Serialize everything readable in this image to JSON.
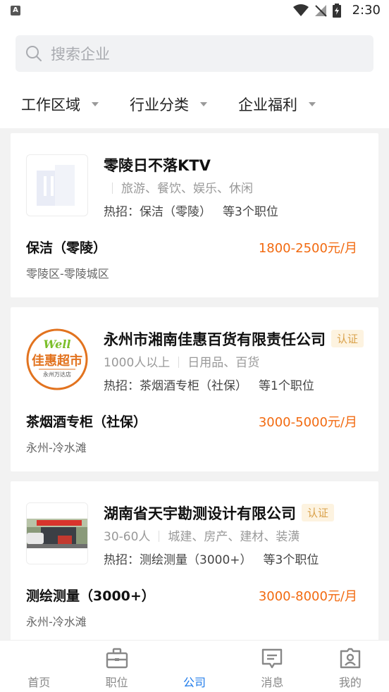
{
  "status_bar": {
    "time": "2:30",
    "left_icon": "A"
  },
  "search": {
    "placeholder": "搜索企业",
    "value": ""
  },
  "filters": [
    {
      "label": "工作区域"
    },
    {
      "label": "行业分类"
    },
    {
      "label": "企业福利"
    }
  ],
  "companies": [
    {
      "name": "零陵日不落KTV",
      "certified": false,
      "size": "",
      "industry": "旅游、餐饮、娱乐、休闲",
      "hot_prefix": "热招：",
      "hot_job": "保洁（零陵）",
      "hot_more": "等3个职位",
      "job_title": "保洁（零陵）",
      "salary": "1800-2500元/月",
      "location": "零陵区-零陵城区",
      "logo": "building-placeholder-icon"
    },
    {
      "name": "永州市湘南佳惠百货有限责任公司",
      "certified": true,
      "badge": "认证",
      "size": "1000人以上",
      "industry": "日用品、百货",
      "hot_prefix": "热招：",
      "hot_job": "茶烟酒专柜（社保）",
      "hot_more": "等1个职位",
      "job_title": "茶烟酒专柜（社保）",
      "salary": "3000-5000元/月",
      "location": "永州-冷水滩",
      "logo": "jiahui-supermarket-logo",
      "logo_text": {
        "well": "Well",
        "name": "佳惠超市",
        "branch": "永州万达店"
      }
    },
    {
      "name": "湖南省天宇勘测设计有限公司",
      "certified": true,
      "badge": "认证",
      "size": "30-60人",
      "industry": "城建、房产、建材、装潢",
      "hot_prefix": "热招：",
      "hot_job": "测绘测量（3000+）",
      "hot_more": "等3个职位",
      "job_title": "测绘测量（3000+）",
      "salary": "3000-8000元/月",
      "location": "永州-冷水滩",
      "logo": "storefront-photo"
    }
  ],
  "tabs": [
    {
      "label": "首页",
      "icon": "home-icon",
      "active": false
    },
    {
      "label": "职位",
      "icon": "briefcase-icon",
      "active": false
    },
    {
      "label": "公司",
      "icon": "company-icon",
      "active": true
    },
    {
      "label": "消息",
      "icon": "message-icon",
      "active": false
    },
    {
      "label": "我的",
      "icon": "profile-icon",
      "active": false
    }
  ],
  "colors": {
    "accent": "#1f7bea",
    "salary": "#f26a10",
    "badge_bg": "#fdf3e0",
    "badge_text": "#d9a14a",
    "logo_orange": "#e2731f",
    "logo_green": "#7bbf2a"
  }
}
